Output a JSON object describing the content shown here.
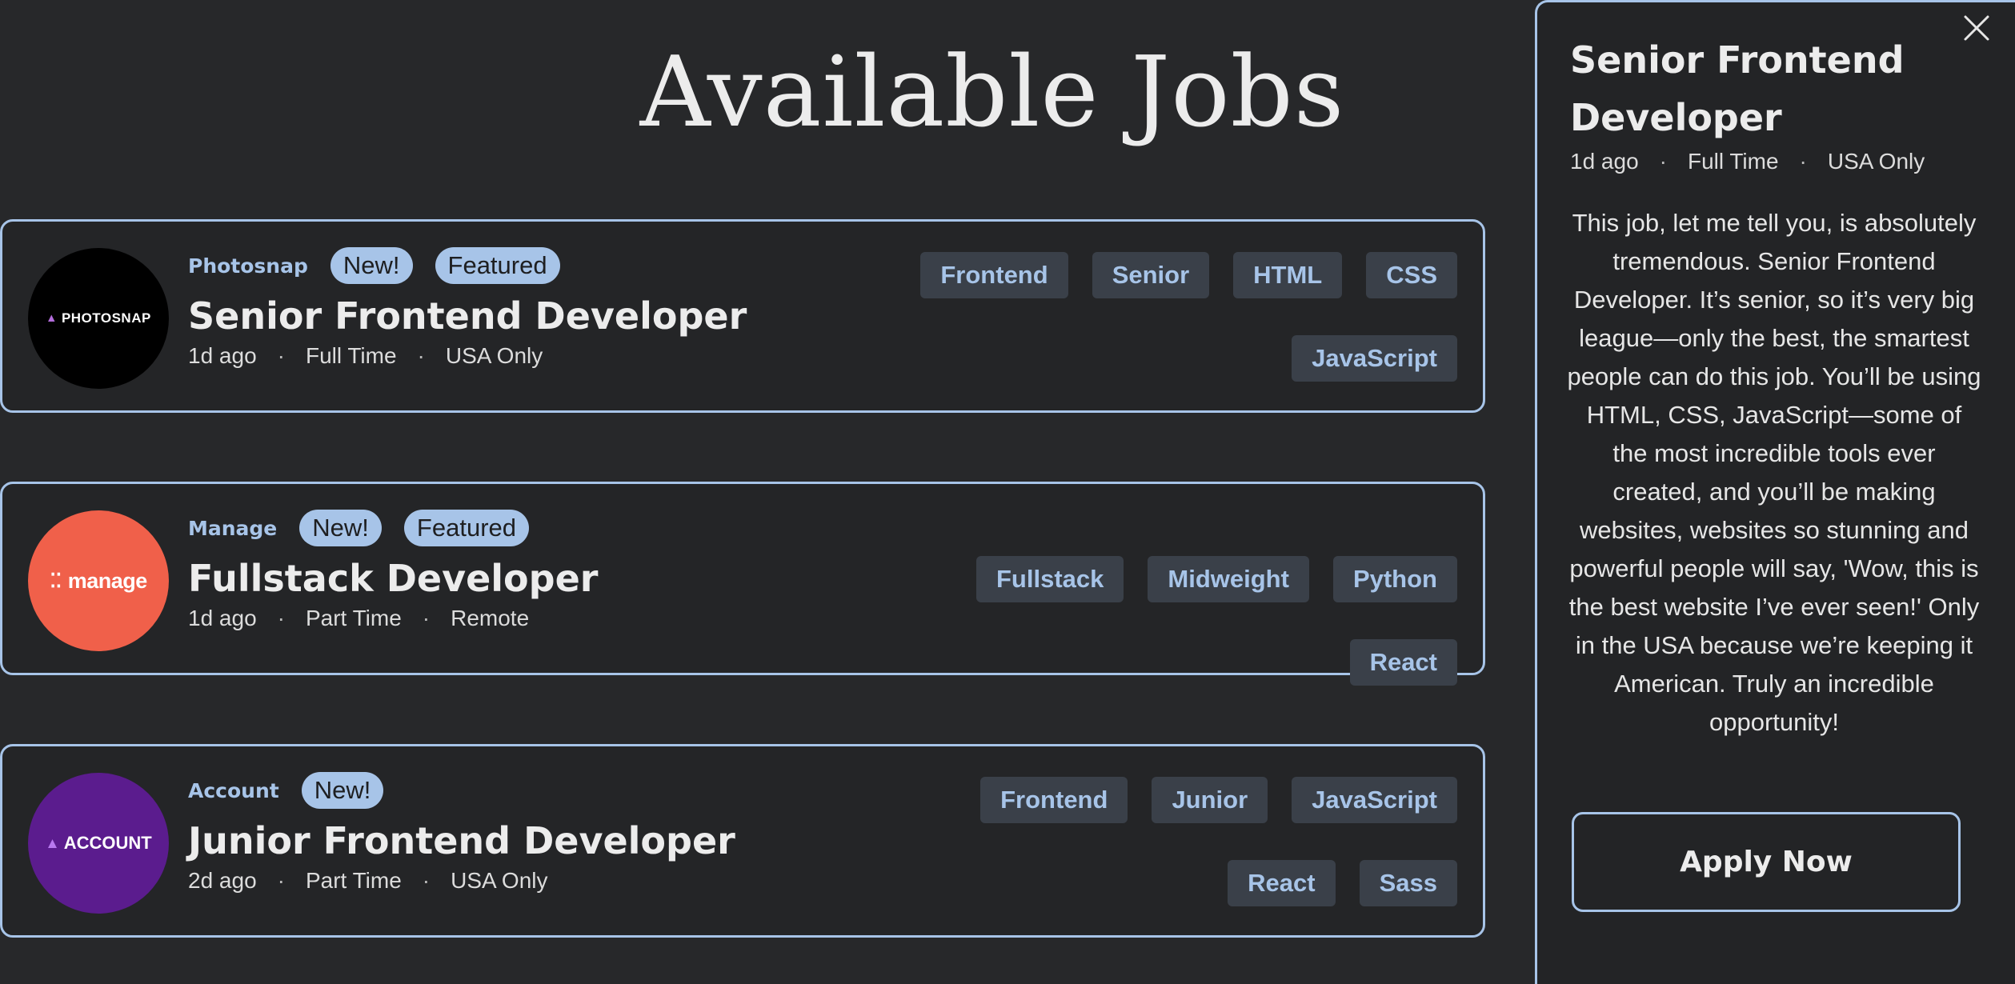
{
  "page": {
    "title": "Available Jobs"
  },
  "jobs": [
    {
      "company": "Photosnap",
      "logo_text": "PHOTOSNAP",
      "new_label": "New!",
      "featured_label": "Featured",
      "position": "Senior Frontend Developer",
      "posted": "1d ago",
      "contract": "Full Time",
      "location": "USA Only",
      "tags": [
        "Frontend",
        "Senior",
        "HTML",
        "CSS",
        "JavaScript"
      ]
    },
    {
      "company": "Manage",
      "logo_text": "manage",
      "new_label": "New!",
      "featured_label": "Featured",
      "position": "Fullstack Developer",
      "posted": "1d ago",
      "contract": "Part Time",
      "location": "Remote",
      "tags": [
        "Fullstack",
        "Midweight",
        "Python",
        "React"
      ]
    },
    {
      "company": "Account",
      "logo_text": "ACCOUNT",
      "new_label": "New!",
      "position": "Junior Frontend Developer",
      "posted": "2d ago",
      "contract": "Part Time",
      "location": "USA Only",
      "tags": [
        "Frontend",
        "Junior",
        "JavaScript",
        "React",
        "Sass"
      ]
    }
  ],
  "detail": {
    "title": "Senior Frontend Developer",
    "posted": "1d ago",
    "contract": "Full Time",
    "location": "USA Only",
    "description": "This job, let me tell you, is absolutely tremendous. Senior Frontend Developer. It’s senior, so it’s very big league—only the best, the smartest people can do this job. You’ll be using HTML, CSS, JavaScript—some of the most incredible tools ever created, and you’ll be making websites, websites so stunning and powerful people will say, 'Wow, this is the best website I’ve ever seen!' Only in the USA because we’re keeping it American. Truly an incredible opportunity!",
    "apply_label": "Apply Now",
    "close_icon": "close-icon"
  },
  "separator": "·",
  "colors": {
    "background": "#27282a",
    "accent": "#a7c4e8",
    "tag_background": "#3a4049",
    "photosnap_logo": "#000000",
    "manage_logo": "#f0604a",
    "account_logo": "#5b1c8e"
  }
}
